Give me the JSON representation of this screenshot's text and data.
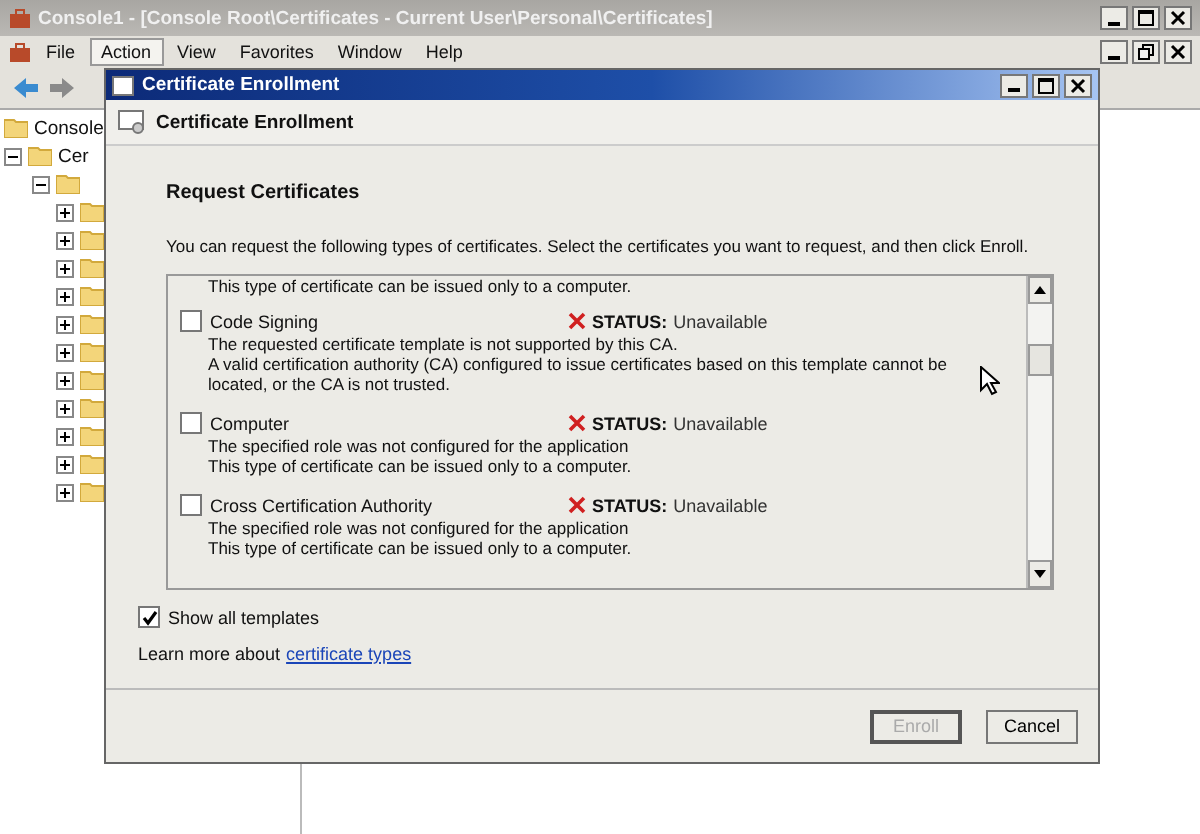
{
  "main_window": {
    "title": "Console1 - [Console Root\\Certificates - Current User\\Personal\\Certificates]",
    "menu": [
      {
        "label": "File",
        "selected": false
      },
      {
        "label": "Action",
        "selected": true
      },
      {
        "label": "View",
        "selected": false
      },
      {
        "label": "Favorites",
        "selected": false
      },
      {
        "label": "Window",
        "selected": false
      },
      {
        "label": "Help",
        "selected": false
      }
    ]
  },
  "tree": {
    "items": [
      {
        "label": "Console"
      },
      {
        "label": "Cer",
        "expanded": true,
        "children": [
          {
            "expanded": true,
            "children": [
              {
                "expanded": false
              },
              {
                "expanded": false
              },
              {
                "expanded": false
              },
              {
                "expanded": false
              },
              {
                "expanded": false
              },
              {
                "expanded": false
              },
              {
                "expanded": false
              },
              {
                "expanded": false
              },
              {
                "expanded": false
              },
              {
                "expanded": false
              },
              {
                "expanded": false
              }
            ]
          }
        ]
      }
    ]
  },
  "dialog": {
    "title": "Certificate Enrollment",
    "header": "Certificate Enrollment",
    "heading": "Request Certificates",
    "intro": "You can request the following types of certificates. Select the certificates you want to request, and then click Enroll.",
    "list_top_text": "This type of certificate can be issued only to a computer.",
    "templates": [
      {
        "name": "Code Signing",
        "checked": false,
        "status_label": "STATUS:",
        "status": "Unavailable",
        "details": [
          "The requested certificate template is not supported by this CA.",
          "A valid certification authority (CA) configured to issue certificates based on this template cannot be located, or the CA is not trusted."
        ]
      },
      {
        "name": "Computer",
        "checked": false,
        "status_label": "STATUS:",
        "status": "Unavailable",
        "details": [
          "The specified role was not configured for the application",
          "This type of certificate can be issued only to a computer."
        ]
      },
      {
        "name": "Cross Certification Authority",
        "checked": false,
        "status_label": "STATUS:",
        "status": "Unavailable",
        "details": [
          "The specified role was not configured for the application",
          "This type of certificate can be issued only to a computer."
        ]
      }
    ],
    "show_all": {
      "label": "Show all templates",
      "checked": true
    },
    "learn_more": {
      "text": "Learn more about",
      "link": "certificate types"
    },
    "buttons": [
      {
        "label": "Enroll",
        "disabled": true
      },
      {
        "label": "Cancel",
        "disabled": false
      }
    ]
  }
}
